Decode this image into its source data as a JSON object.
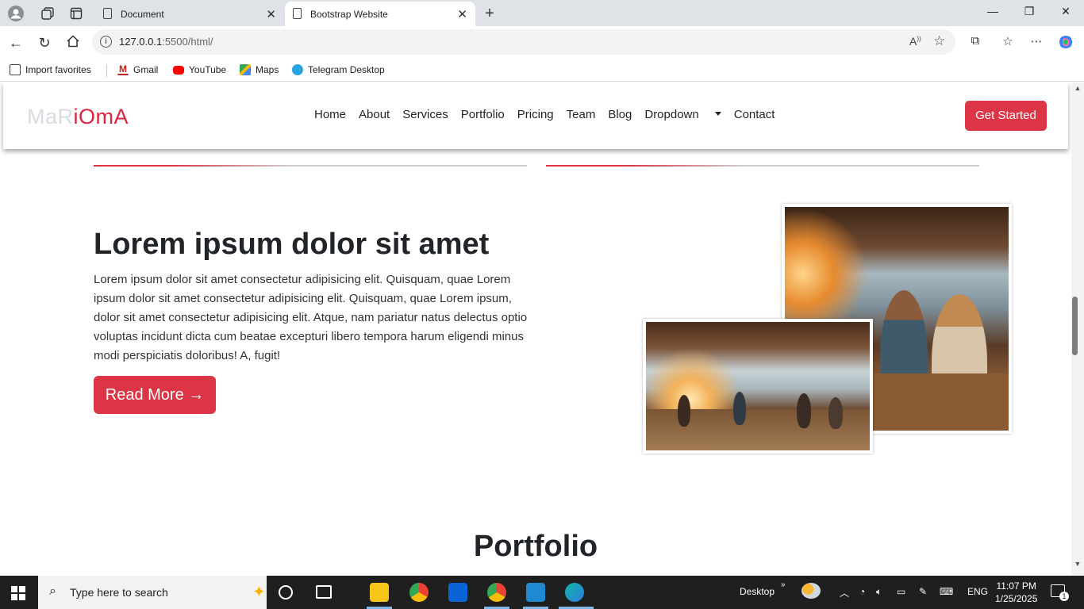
{
  "browser": {
    "tabs": [
      {
        "title": "Document",
        "active": false
      },
      {
        "title": "Bootstrap Website",
        "active": true
      }
    ],
    "address": {
      "host": "127.0.0.1",
      "rest": ":5500/html/"
    },
    "favorites": [
      "Import favorites",
      "Gmail",
      "YouTube",
      "Maps",
      "Telegram Desktop"
    ]
  },
  "site": {
    "logo": {
      "light": "MaR",
      "accent": "iOmA"
    },
    "menu": [
      "Home",
      "About",
      "Services",
      "Portfolio",
      "Pricing",
      "Team",
      "Blog",
      "Dropdown",
      "Contact"
    ],
    "cta": "Get Started",
    "hero": {
      "title": "Lorem ipsum dolor sit amet",
      "text": "Lorem ipsum dolor sit amet consectetur adipisicing elit. Quisquam, quae Lorem ipsum dolor sit amet consectetur adipisicing elit. Quisquam, quae Lorem ipsum, dolor sit amet consectetur adipisicing elit. Atque, nam pariatur natus delectus optio voluptas incidunt dicta cum beatae excepturi libero tempora harum eligendi minus modi perspiciatis doloribus! A, fugit!",
      "button": "Read More →"
    },
    "section_title": "Portfolio"
  },
  "taskbar": {
    "search_placeholder": "Type here to search",
    "desktop_label": "Desktop",
    "language": "ENG",
    "time": "11:07 PM",
    "date": "1/25/2025",
    "notification_count": "1"
  },
  "colors": {
    "accent": "#dc3545",
    "logo_red": "#e0243f"
  }
}
